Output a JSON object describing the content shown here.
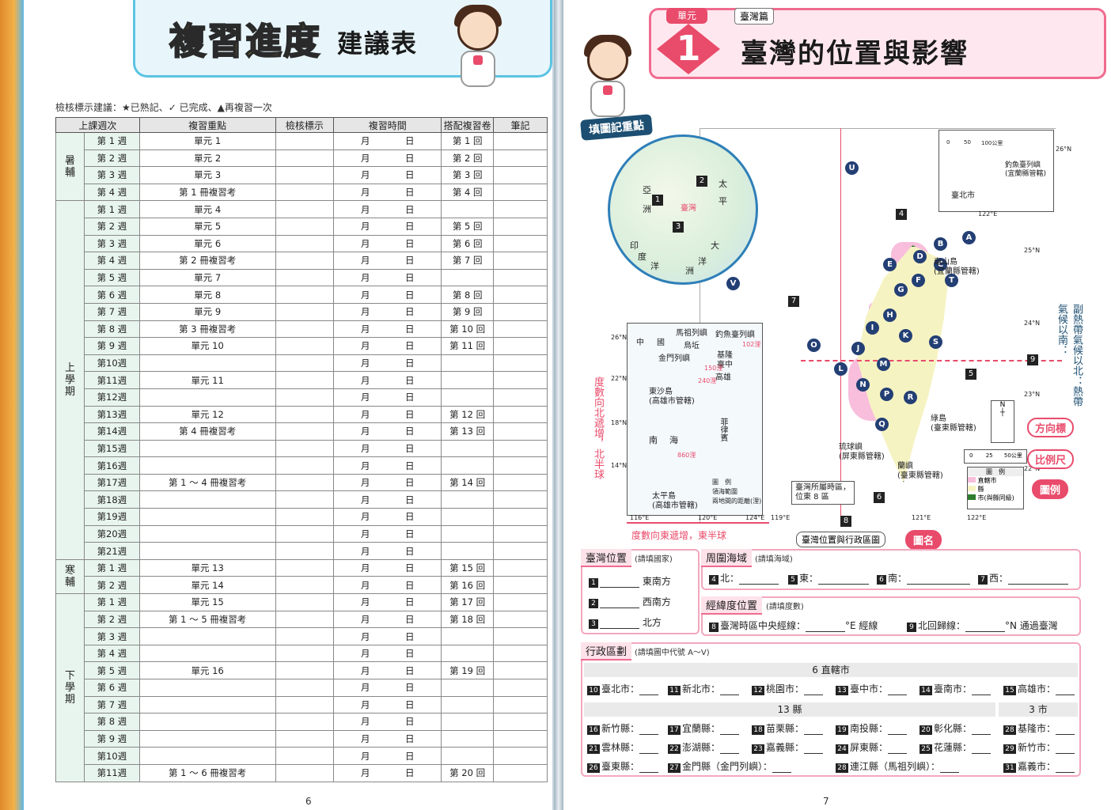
{
  "left": {
    "title_main": "複習進度",
    "title_sub": "建議表",
    "legend": "檢核標示建議：★已熟記、✓ 已完成、▲再複習一次",
    "headers": [
      "上課週次",
      "複習重點",
      "檢核標示",
      "複習時間",
      "搭配複習卷",
      "筆記"
    ],
    "month": "月",
    "day": "日",
    "sections": [
      {
        "name": "暑\n輔",
        "rows": [
          {
            "wk": "第 1 週",
            "focus": "單元 1",
            "exam": "第 1 回"
          },
          {
            "wk": "第 2 週",
            "focus": "單元 2",
            "exam": "第 2 回"
          },
          {
            "wk": "第 3 週",
            "focus": "單元 3",
            "exam": "第 3 回"
          },
          {
            "wk": "第 4 週",
            "focus": "第 1 冊複習考",
            "exam": "第 4 回"
          }
        ]
      },
      {
        "name": "上\n學\n期",
        "rows": [
          {
            "wk": "第 1 週",
            "focus": "單元 4",
            "exam": ""
          },
          {
            "wk": "第 2 週",
            "focus": "單元 5",
            "exam": "第 5 回"
          },
          {
            "wk": "第 3 週",
            "focus": "單元 6",
            "exam": "第 6 回"
          },
          {
            "wk": "第 4 週",
            "focus": "第 2 冊複習考",
            "exam": "第 7 回"
          },
          {
            "wk": "第 5 週",
            "focus": "單元 7",
            "exam": ""
          },
          {
            "wk": "第 6 週",
            "focus": "單元 8",
            "exam": "第 8 回"
          },
          {
            "wk": "第 7 週",
            "focus": "單元 9",
            "exam": "第 9 回"
          },
          {
            "wk": "第 8 週",
            "focus": "第 3 冊複習考",
            "exam": "第 10 回"
          },
          {
            "wk": "第 9 週",
            "focus": "單元 10",
            "exam": "第 11 回"
          },
          {
            "wk": "第10週",
            "focus": "",
            "exam": ""
          },
          {
            "wk": "第11週",
            "focus": "單元 11",
            "exam": ""
          },
          {
            "wk": "第12週",
            "focus": "",
            "exam": ""
          },
          {
            "wk": "第13週",
            "focus": "單元 12",
            "exam": "第 12 回"
          },
          {
            "wk": "第14週",
            "focus": "第 4 冊複習考",
            "exam": "第 13 回"
          },
          {
            "wk": "第15週",
            "focus": "",
            "exam": ""
          },
          {
            "wk": "第16週",
            "focus": "",
            "exam": ""
          },
          {
            "wk": "第17週",
            "focus": "第 1 ～ 4 冊複習考",
            "exam": "第 14 回"
          },
          {
            "wk": "第18週",
            "focus": "",
            "exam": ""
          },
          {
            "wk": "第19週",
            "focus": "",
            "exam": ""
          },
          {
            "wk": "第20週",
            "focus": "",
            "exam": ""
          },
          {
            "wk": "第21週",
            "focus": "",
            "exam": ""
          }
        ]
      },
      {
        "name": "寒\n輔",
        "rows": [
          {
            "wk": "第 1 週",
            "focus": "單元 13",
            "exam": "第 15 回"
          },
          {
            "wk": "第 2 週",
            "focus": "單元 14",
            "exam": "第 16 回"
          }
        ]
      },
      {
        "name": "下\n學\n期",
        "rows": [
          {
            "wk": "第 1 週",
            "focus": "單元 15",
            "exam": "第 17 回"
          },
          {
            "wk": "第 2 週",
            "focus": "第 1 ～ 5 冊複習考",
            "exam": "第 18 回"
          },
          {
            "wk": "第 3 週",
            "focus": "",
            "exam": ""
          },
          {
            "wk": "第 4 週",
            "focus": "",
            "exam": ""
          },
          {
            "wk": "第 5 週",
            "focus": "單元 16",
            "exam": "第 19 回"
          },
          {
            "wk": "第 6 週",
            "focus": "",
            "exam": ""
          },
          {
            "wk": "第 7 週",
            "focus": "",
            "exam": ""
          },
          {
            "wk": "第 8 週",
            "focus": "",
            "exam": ""
          },
          {
            "wk": "第 9 週",
            "focus": "",
            "exam": ""
          },
          {
            "wk": "第10週",
            "focus": "",
            "exam": ""
          },
          {
            "wk": "第11週",
            "focus": "第 1 ～ 6 冊複習考",
            "exam": "第 20 回"
          }
        ]
      }
    ],
    "page_number": "6"
  },
  "right": {
    "unit_label": "單元",
    "unit_number": "1",
    "section_tag": "臺灣篇",
    "title": "臺灣的位置與影響",
    "fill_tag": "填圖記重點",
    "map": {
      "globe_labels": [
        "亞",
        "洲",
        "臺灣",
        "太",
        "平",
        "大",
        "洋",
        "洲",
        "印",
        "度",
        "洋"
      ],
      "sea_inset_labels": [
        "中",
        "國",
        "馬祖列嶼",
        "烏坵",
        "金門列嶼",
        "釣魚臺列嶼",
        "基隆",
        "臺中",
        "高雄",
        "東沙島\n(高雄市管轄)",
        "南",
        "海",
        "菲律賓",
        "太平島\n(高雄市管轄)",
        "240浬",
        "102浬",
        "150浬",
        "860浬"
      ],
      "inset_legend_title": "圖　例",
      "inset_legend_items": [
        "領海範圍",
        "兩地間的距離(浬)"
      ],
      "sea_lat": [
        "26°N",
        "22°N",
        "18°N",
        "14°N"
      ],
      "sea_lon": [
        "116°E",
        "120°E",
        "124°E"
      ],
      "taipei_inset": {
        "scale": [
          "0",
          "50",
          "100公里"
        ],
        "label1": "釣魚臺列嶼\n(宜蘭縣管轄)",
        "label2": "臺北市",
        "lat": "26°N",
        "lon": "122°E"
      },
      "main_labels": [
        "龜山島\n(宜蘭縣管轄)",
        "綠島\n(臺東縣管轄)",
        "琉球嶼\n(屏東縣管轄)",
        "蘭嶼\n(臺東縣管轄)",
        "臺灣所屬時區，\n位東 8 區"
      ],
      "main_lat": [
        "25°N",
        "24°N",
        "23°N",
        "22°N"
      ],
      "main_lon": [
        "119°E",
        "121°E",
        "122°E"
      ],
      "markers": [
        "U",
        "B",
        "A",
        "D",
        "C",
        "E",
        "T",
        "G",
        "F",
        "H",
        "V",
        "I",
        "K",
        "S",
        "O",
        "J",
        "L",
        "M",
        "N",
        "P",
        "R",
        "Q"
      ],
      "num_markers": [
        "1",
        "2",
        "3",
        "4",
        "5",
        "6",
        "7",
        "8",
        "9"
      ],
      "right_vertical": "副熱帶氣候以北：熱帶氣候以南：",
      "left_vertical": "度數向北遞增，北半球",
      "bottom_caption": "度數向東遞增，東半球",
      "map_name": "臺灣位置與行政區圖",
      "legend_title": "圖　例",
      "legend_items": [
        "直轄市",
        "縣",
        "市(與縣同級)"
      ],
      "scale": [
        "0",
        "25",
        "50公里"
      ]
    },
    "side_labels": [
      "方向標",
      "比例尺",
      "圖例",
      "圖名"
    ],
    "taiwan_position": {
      "head": "臺灣位置",
      "hint": "(請填國家)",
      "items": [
        {
          "n": "1",
          "dir": "東南方"
        },
        {
          "n": "2",
          "dir": "西南方"
        },
        {
          "n": "3",
          "dir": "北方"
        }
      ]
    },
    "seas": {
      "head": "周圍海域",
      "hint": "(請填海域)",
      "items": [
        {
          "n": "4",
          "d": "北："
        },
        {
          "n": "5",
          "d": "東："
        },
        {
          "n": "6",
          "d": "南："
        },
        {
          "n": "7",
          "d": "西："
        }
      ]
    },
    "latlon": {
      "head": "經緯度位置",
      "hint": "(請填度數)",
      "q8": "臺灣時區中央經線：",
      "q8_unit": "°E 經線",
      "q9": "北回歸線：",
      "q9_unit": "°N 通過臺灣"
    },
    "admin": {
      "head": "行政區劃",
      "hint": "(請填圖中代號 A～V)",
      "cities_title": "6 直轄市",
      "counties_title": "13 縣",
      "cities3_title": "3 市",
      "row1": [
        {
          "n": "10",
          "t": "臺北市："
        },
        {
          "n": "11",
          "t": "新北市："
        },
        {
          "n": "12",
          "t": "桃園市："
        },
        {
          "n": "13",
          "t": "臺中市："
        },
        {
          "n": "14",
          "t": "臺南市："
        },
        {
          "n": "15",
          "t": "高雄市："
        }
      ],
      "row2": [
        {
          "n": "16",
          "t": "新竹縣："
        },
        {
          "n": "17",
          "t": "宜蘭縣："
        },
        {
          "n": "18",
          "t": "苗栗縣："
        },
        {
          "n": "19",
          "t": "南投縣："
        },
        {
          "n": "20",
          "t": "彰化縣："
        },
        {
          "n": "28",
          "t": "基隆市："
        }
      ],
      "row3": [
        {
          "n": "21",
          "t": "雲林縣："
        },
        {
          "n": "22",
          "t": "澎湖縣："
        },
        {
          "n": "23",
          "t": "嘉義縣："
        },
        {
          "n": "24",
          "t": "屏東縣："
        },
        {
          "n": "25",
          "t": "花蓮縣："
        },
        {
          "n": "29",
          "t": "新竹市："
        }
      ],
      "row4": [
        {
          "n": "26",
          "t": "臺東縣："
        },
        {
          "n": "27",
          "t": "金門縣（金門列嶼）："
        },
        {
          "n": "",
          "t": ""
        },
        {
          "n": "28",
          "t": "連江縣（馬祖列嶼）："
        },
        {
          "n": "",
          "t": ""
        },
        {
          "n": "31",
          "t": "嘉義市："
        }
      ]
    },
    "page_number": "7"
  }
}
